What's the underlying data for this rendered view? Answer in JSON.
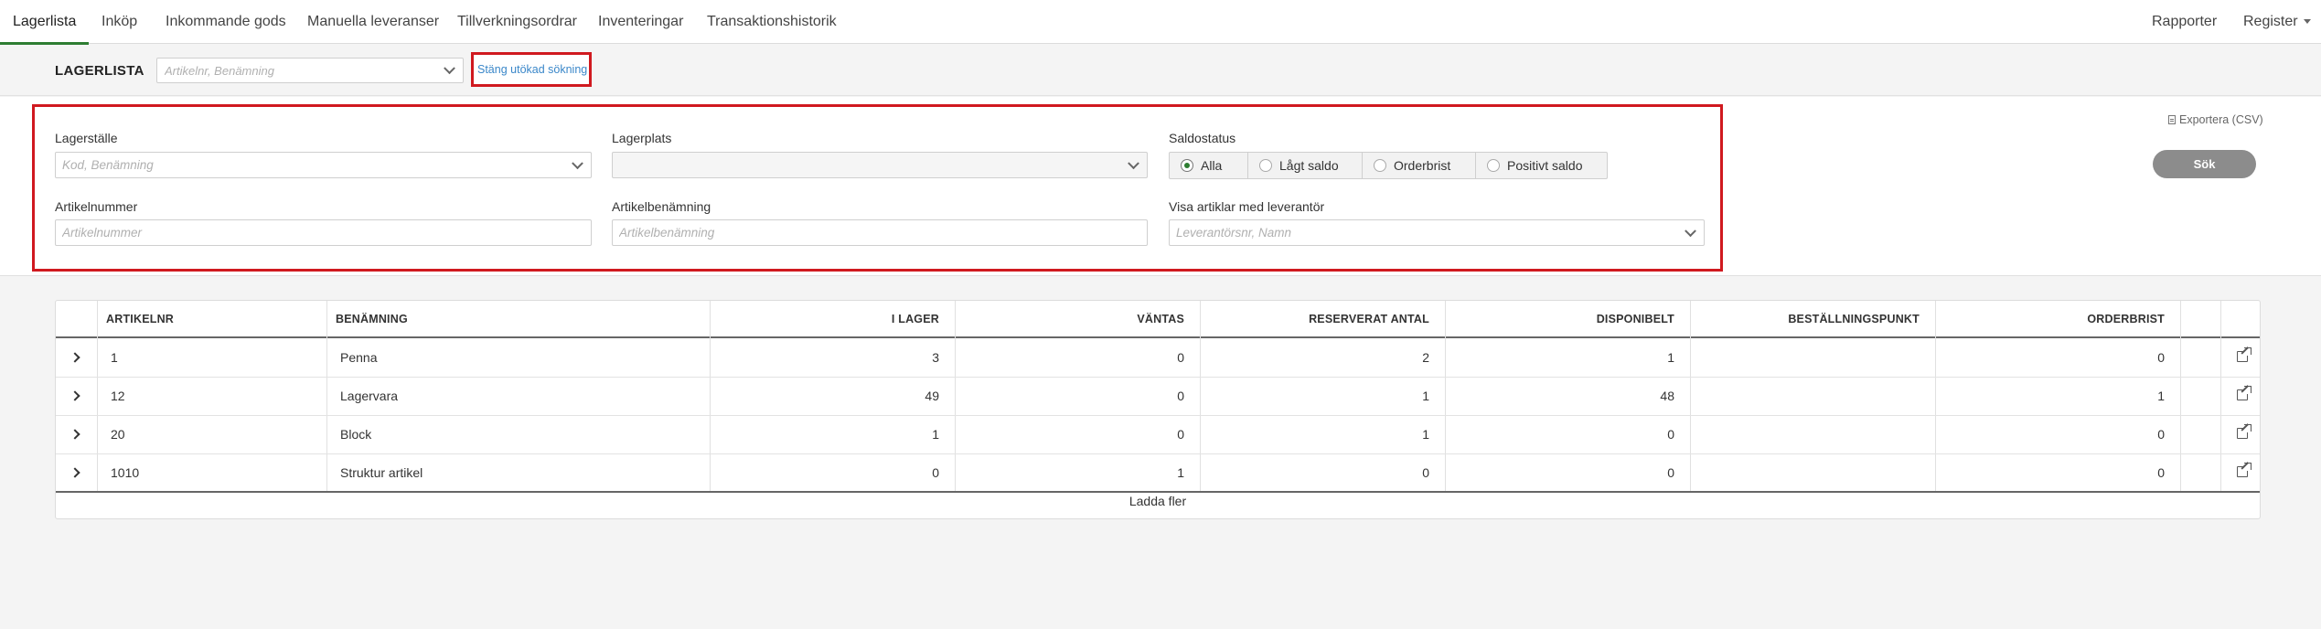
{
  "nav": {
    "tabs": [
      {
        "label": "Lagerlista"
      },
      {
        "label": "Inköp"
      },
      {
        "label": "Inkommande gods"
      },
      {
        "label": "Manuella leveranser"
      },
      {
        "label": "Tillverkningsordrar"
      },
      {
        "label": "Inventeringar"
      },
      {
        "label": "Transaktionshistorik"
      }
    ],
    "right": {
      "reports": "Rapporter",
      "register": "Register"
    }
  },
  "header": {
    "title": "LAGERLISTA",
    "search_placeholder": "Artikelnr, Benämning",
    "close_advanced": "Stäng utökad sökning"
  },
  "filters": {
    "warehouse": {
      "label": "Lagerställe",
      "placeholder": "Kod, Benämning"
    },
    "location": {
      "label": "Lagerplats",
      "placeholder": ""
    },
    "balance_status": {
      "label": "Saldostatus",
      "options": [
        "Alla",
        "Lågt saldo",
        "Orderbrist",
        "Positivt saldo"
      ],
      "selected": "Alla"
    },
    "article_number": {
      "label": "Artikelnummer",
      "placeholder": "Artikelnummer"
    },
    "article_name": {
      "label": "Artikelbenämning",
      "placeholder": "Artikelbenämning"
    },
    "supplier": {
      "label": "Visa artiklar med leverantör",
      "placeholder": "Leverantörsnr, Namn"
    },
    "export": "Exportera (CSV)",
    "search_button": "Sök"
  },
  "table": {
    "columns": [
      "ARTIKELNR",
      "BENÄMNING",
      "I LAGER",
      "VÄNTAS",
      "RESERVERAT ANTAL",
      "DISPONIBELT",
      "BESTÄLLNINGSPUNKT",
      "ORDERBRIST"
    ],
    "rows": [
      {
        "artikelnr": "1",
        "benamning": "Penna",
        "i_lager": "3",
        "vantas": "0",
        "reserverat": "2",
        "disponibelt": "1",
        "bestallningspunkt": "",
        "orderbrist": "0"
      },
      {
        "artikelnr": "12",
        "benamning": "Lagervara",
        "i_lager": "49",
        "vantas": "0",
        "reserverat": "1",
        "disponibelt": "48",
        "bestallningspunkt": "",
        "orderbrist": "1"
      },
      {
        "artikelnr": "20",
        "benamning": "Block",
        "i_lager": "1",
        "vantas": "0",
        "reserverat": "1",
        "disponibelt": "0",
        "bestallningspunkt": "",
        "orderbrist": "0"
      },
      {
        "artikelnr": "1010",
        "benamning": "Struktur artikel",
        "i_lager": "0",
        "vantas": "1",
        "reserverat": "0",
        "disponibelt": "0",
        "bestallningspunkt": "",
        "orderbrist": "0"
      }
    ],
    "load_more": "Ladda fler"
  },
  "colors": {
    "accent": "#2e7d32",
    "highlight": "#d0191f",
    "link": "#3a87c9"
  }
}
